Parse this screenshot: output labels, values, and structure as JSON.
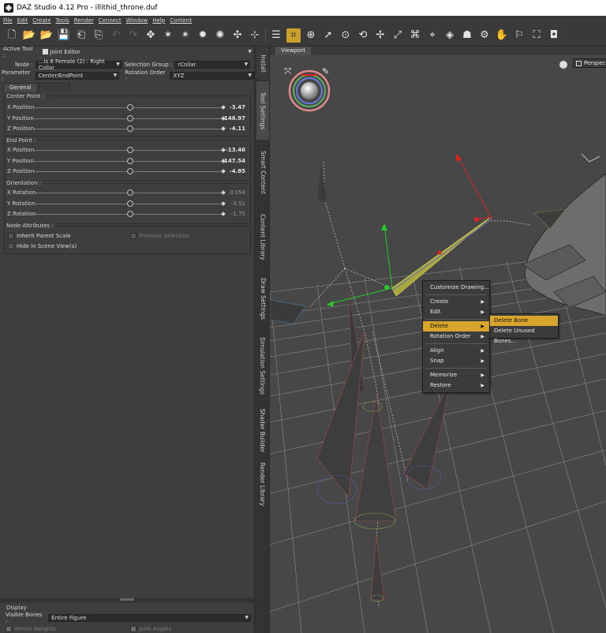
{
  "window": {
    "title": "DAZ Studio 4.12 Pro - illithid_throne.duf"
  },
  "menu": [
    "File",
    "Edit",
    "Create",
    "Tools",
    "Render",
    "Connect",
    "Window",
    "Help",
    "Content"
  ],
  "active_tool": {
    "label": "Active Tool :",
    "value": "Joint Editor"
  },
  "node": {
    "label": "Node :",
    "value": "...is 8 Female (2) : Right Collar"
  },
  "selection_group": {
    "label": "Selection Group :",
    "value": "rCollar"
  },
  "parameter": {
    "label": "Parameter :",
    "value": "Center/EndPoint"
  },
  "rotation_order": {
    "label": "Rotation Order :",
    "value": "XYZ"
  },
  "tabs": [
    "General"
  ],
  "center_point": {
    "title": "Center Point :",
    "rows": [
      {
        "label": "X Position",
        "value": "-3.47"
      },
      {
        "label": "Y Position",
        "value": "146.97"
      },
      {
        "label": "Z Position",
        "value": "-4.11"
      }
    ]
  },
  "end_point": {
    "title": "End Point :",
    "rows": [
      {
        "label": "X Position",
        "value": "-13.46"
      },
      {
        "label": "Y Position",
        "value": "147.54"
      },
      {
        "label": "Z Position",
        "value": "-4.85"
      }
    ]
  },
  "orientation": {
    "title": "Orientation :",
    "rows": [
      {
        "label": "X Rotation",
        "value": "0.054"
      },
      {
        "label": "Y Rotation",
        "value": "-3.51"
      },
      {
        "label": "Z Rotation",
        "value": "-1.75"
      }
    ]
  },
  "node_attributes": {
    "title": "Node Attributes :",
    "inherit_parent_scale": "Inherit Parent Scale",
    "promote_selection": "Promote Selection",
    "hide_in_scene_view": "Hide in Scene View(s)"
  },
  "side_tabs": [
    "Install",
    "Tool Settings",
    "Smart Content",
    "Content Library",
    "Draw Settings",
    "Simulation Settings",
    "Shader Builder",
    "Render Library"
  ],
  "viewport": {
    "tab": "Viewport",
    "camera": "Perspec"
  },
  "context_menu": [
    {
      "label": "Customize Drawing...",
      "arrow": ""
    },
    {
      "label": "Create",
      "arrow": "▶"
    },
    {
      "label": "Edit",
      "arrow": "▶"
    },
    {
      "label": "Delete",
      "arrow": "▶"
    },
    {
      "label": "Rotation Order",
      "arrow": "▶"
    },
    {
      "label": "Align",
      "arrow": "▶"
    },
    {
      "label": "Snap",
      "arrow": "▶"
    },
    {
      "label": "Memorize",
      "arrow": "▶"
    },
    {
      "label": "Restore",
      "arrow": "▶"
    }
  ],
  "submenu": [
    {
      "label": "Delete Bone"
    },
    {
      "label": "Delete Unused Bones..."
    }
  ],
  "display": {
    "title": "Display",
    "visible_bones_label": "Visible Bones :",
    "visible_bones_value": "Entire Figure",
    "vertex_weights": "Vertex Weights",
    "joint_angles": "Joint Angles"
  },
  "colors": {
    "accent": "#d7a52c",
    "panel": "#3e3e3e",
    "viewport": "#474747"
  }
}
